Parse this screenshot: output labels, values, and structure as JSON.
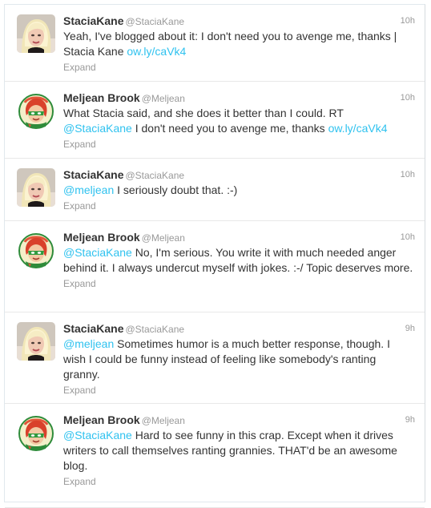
{
  "tweets": [
    {
      "user": "stacia",
      "fullname": "StaciaKane",
      "username": "@StaciaKane",
      "time": "10h",
      "parts": [
        {
          "t": "text",
          "v": "Yeah, I've blogged about it: I don't need you to avenge me, thanks | Stacia Kane "
        },
        {
          "t": "link",
          "v": "ow.ly/caVk4"
        }
      ],
      "expand": "Expand"
    },
    {
      "user": "meljean",
      "fullname": "Meljean Brook",
      "username": "@Meljean",
      "time": "10h",
      "parts": [
        {
          "t": "text",
          "v": "What Stacia said, and she does it better than I could. RT "
        },
        {
          "t": "link",
          "v": "@StaciaKane"
        },
        {
          "t": "text",
          "v": " I don't need you to avenge me, thanks "
        },
        {
          "t": "link",
          "v": "ow.ly/caVk4"
        }
      ],
      "expand": "Expand"
    },
    {
      "user": "stacia",
      "fullname": "StaciaKane",
      "username": "@StaciaKane",
      "time": "10h",
      "parts": [
        {
          "t": "link",
          "v": "@meljean"
        },
        {
          "t": "text",
          "v": " I seriously doubt that. :-)"
        }
      ],
      "expand": "Expand"
    },
    {
      "user": "meljean",
      "fullname": "Meljean Brook",
      "username": "@Meljean",
      "time": "10h",
      "parts": [
        {
          "t": "link",
          "v": "@StaciaKane"
        },
        {
          "t": "text",
          "v": " No, I'm serious. You write it with much needed anger behind it. I always undercut myself with jokes. :-/ Topic deserves more."
        }
      ],
      "expand": "Expand"
    },
    {
      "user": "stacia",
      "fullname": "StaciaKane",
      "username": "@StaciaKane",
      "time": "9h",
      "parts": [
        {
          "t": "link",
          "v": "@meljean"
        },
        {
          "t": "text",
          "v": " Sometimes humor is a much better response, though. I wish I could be funny instead of feeling like somebody's ranting granny."
        }
      ],
      "expand": "Expand"
    },
    {
      "user": "meljean",
      "fullname": "Meljean Brook",
      "username": "@Meljean",
      "time": "9h",
      "parts": [
        {
          "t": "link",
          "v": "@StaciaKane"
        },
        {
          "t": "text",
          "v": " Hard to see funny in this crap. Except when it drives writers to call themselves ranting grannies. THAT'd be an awesome blog."
        }
      ],
      "expand": "Expand"
    }
  ],
  "colors": {
    "link": "#2fc2ef",
    "name": "#333333",
    "meta": "#999999"
  },
  "icons": {
    "stacia": "stacia-avatar-photo",
    "meljean": "meljean-avatar-superhero"
  }
}
